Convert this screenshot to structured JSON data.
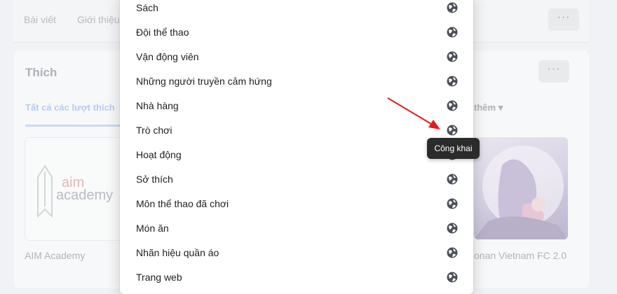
{
  "background": {
    "top_tabs": [
      "Bài viết",
      "Giới thiệu"
    ],
    "more_button": "···",
    "likes_title": "Thích",
    "likes_tab_active": "Tất cả các lượt thích",
    "likes_tab_more": "thêm",
    "tiles": [
      {
        "name": "AIM Academy",
        "logo_top": "aim",
        "logo_bottom": "academy"
      },
      {
        "name": "onan Vietnam FC 2.0"
      }
    ]
  },
  "dropdown": {
    "items": [
      {
        "label": "Sách"
      },
      {
        "label": "Đội thể thao"
      },
      {
        "label": "Vận động viên"
      },
      {
        "label": "Những người truyền cảm hứng"
      },
      {
        "label": "Nhà hàng"
      },
      {
        "label": "Trò chơi"
      },
      {
        "label": "Hoạt động"
      },
      {
        "label": "Sở thích"
      },
      {
        "label": "Môn thể thao đã chơi"
      },
      {
        "label": "Món ăn"
      },
      {
        "label": "Nhãn hiệu quần áo"
      },
      {
        "label": "Trang web"
      }
    ],
    "privacy_icon": "globe-icon"
  },
  "tooltip": {
    "text": "Công khai"
  },
  "annotation": {
    "arrow_color": "#e01e1e"
  }
}
